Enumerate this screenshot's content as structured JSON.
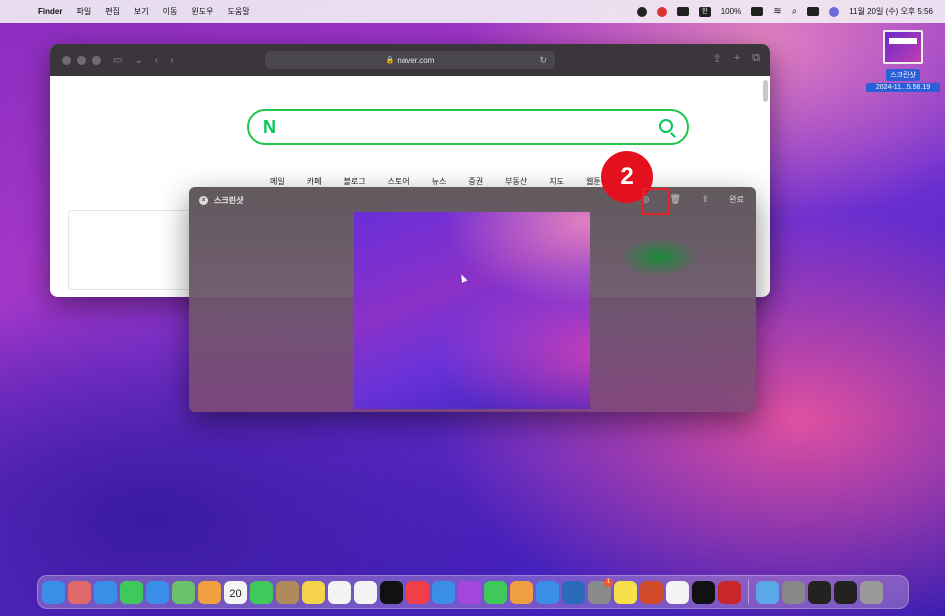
{
  "menubar": {
    "app_name": "Finder",
    "menus": [
      "파일",
      "편집",
      "보기",
      "이동",
      "윈도우",
      "도움말"
    ],
    "input_source": "한",
    "battery": "100%",
    "clock": "11월 20일 (수) 오후 5:56"
  },
  "desktop": {
    "file_label_1": "스크린샷",
    "file_label_2": "2024-11...5.56.19"
  },
  "safari": {
    "url": "naver.com",
    "nav_items": [
      "메일",
      "카페",
      "블로그",
      "스토어",
      "뉴스",
      "증권",
      "부동산",
      "지도",
      "웹툰"
    ],
    "logo": "N"
  },
  "screenshot_panel": {
    "title": "스크린샷",
    "done_label": "완료"
  },
  "annotation": {
    "step": "2",
    "color": "#e5101e"
  },
  "dock": {
    "icons": [
      {
        "name": "finder-icon",
        "color": "#3a8ee8"
      },
      {
        "name": "launchpad-icon",
        "color": "#e06a6a"
      },
      {
        "name": "safari-icon",
        "color": "#3a8ee8"
      },
      {
        "name": "messages-icon",
        "color": "#3fc95a"
      },
      {
        "name": "mail-icon",
        "color": "#3a8ee8"
      },
      {
        "name": "maps-icon",
        "color": "#6ac36a"
      },
      {
        "name": "photos-icon",
        "color": "#f0a040"
      },
      {
        "name": "calendar-icon",
        "color": "#f4f4f4"
      },
      {
        "name": "facetime-icon",
        "color": "#3fc95a"
      },
      {
        "name": "contacts-icon",
        "color": "#b08a5a"
      },
      {
        "name": "notes-icon",
        "color": "#f4d24a"
      },
      {
        "name": "freeform-icon",
        "color": "#f4f4f4"
      },
      {
        "name": "reminders-icon",
        "color": "#f4f4f4"
      },
      {
        "name": "appletv-icon",
        "color": "#111111"
      },
      {
        "name": "music-icon",
        "color": "#f2404a"
      },
      {
        "name": "keynote-icon",
        "color": "#3a8ee8"
      },
      {
        "name": "podcasts-icon",
        "color": "#a446e0"
      },
      {
        "name": "numbers-icon",
        "color": "#3fc95a"
      },
      {
        "name": "pages-icon",
        "color": "#f0a040"
      },
      {
        "name": "appstore-icon",
        "color": "#3a8ee8"
      },
      {
        "name": "xcode-icon",
        "color": "#2a6ab8"
      },
      {
        "name": "system-settings-icon",
        "color": "#8a8a8a"
      },
      {
        "name": "kakaotalk-icon",
        "color": "#f7e04a"
      },
      {
        "name": "powerpoint-icon",
        "color": "#d04a2a"
      },
      {
        "name": "chrome-icon",
        "color": "#f4f4f4"
      },
      {
        "name": "capcut-icon",
        "color": "#111111"
      },
      {
        "name": "filezilla-icon",
        "color": "#c8262a"
      }
    ],
    "calendar_day": "20",
    "settings_badge": "1",
    "trailing_icons": [
      {
        "name": "folder-icon",
        "color": "#5aa8e8"
      },
      {
        "name": "help-icon",
        "color": "#888888"
      },
      {
        "name": "battery-app-icon",
        "color": "#222222"
      },
      {
        "name": "battery-app-2-icon",
        "color": "#222222"
      },
      {
        "name": "trash-icon",
        "color": "#9a9a9a"
      }
    ]
  }
}
